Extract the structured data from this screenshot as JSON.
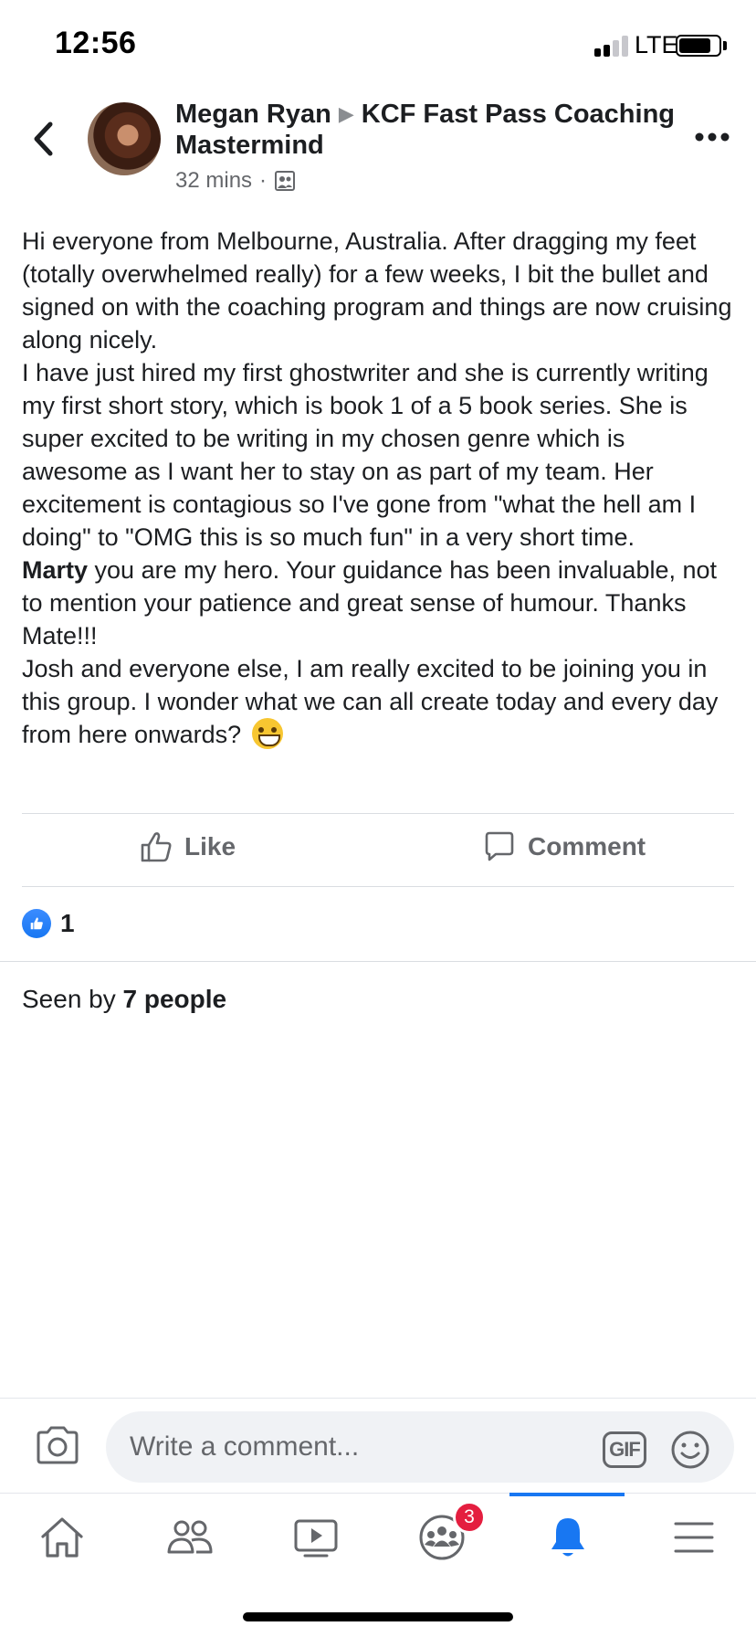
{
  "status_bar": {
    "time": "12:56",
    "network": "LTE",
    "signal_bars_filled": 2,
    "signal_bars_total": 4
  },
  "post": {
    "author": "Megan Ryan",
    "group": "KCF Fast Pass Coaching Mastermind",
    "timestamp": "32 mins",
    "separator": "·",
    "audience_icon": "group-members-icon",
    "paragraphs": [
      "Hi everyone from Melbourne, Australia.  After dragging my feet (totally overwhelmed really) for a few weeks, I bit the bullet and signed on with the coaching program and things are now cruising along nicely.",
      "I have just hired my first ghostwriter and she is currently writing my first short story, which is book 1 of a 5 book series.  She is super excited to be writing in my chosen genre which is awesome as I want her to stay on as part of my team.  Her excitement is contagious so I've gone from \"what the hell am I doing\" to \"OMG this is so much fun\" in a very short time."
    ],
    "mention": "Marty",
    "mention_paragraph_rest": " you are my hero.  Your guidance has been invaluable, not to mention your patience and great sense of humour.  Thanks Mate!!!",
    "closing_paragraph": "Josh and everyone else, I am really excited to be joining you in this group.  I wonder what we can all create today and every day from here onwards?",
    "closing_emoji": "grinning-face-emoji"
  },
  "actions": {
    "like_label": "Like",
    "comment_label": "Comment"
  },
  "reactions": {
    "count": "1",
    "type": "like"
  },
  "seen": {
    "prefix": "Seen by ",
    "count_text": "7 people"
  },
  "composer": {
    "placeholder": "Write a comment...",
    "gif_label": "GIF"
  },
  "tab_bar": {
    "tabs": [
      "home",
      "friends",
      "watch",
      "groups",
      "notifications",
      "menu"
    ],
    "active_tab": "notifications",
    "groups_badge": "3"
  },
  "colors": {
    "accent": "#1877f2",
    "badge": "#e41e3f",
    "secondary_text": "#65676b"
  }
}
